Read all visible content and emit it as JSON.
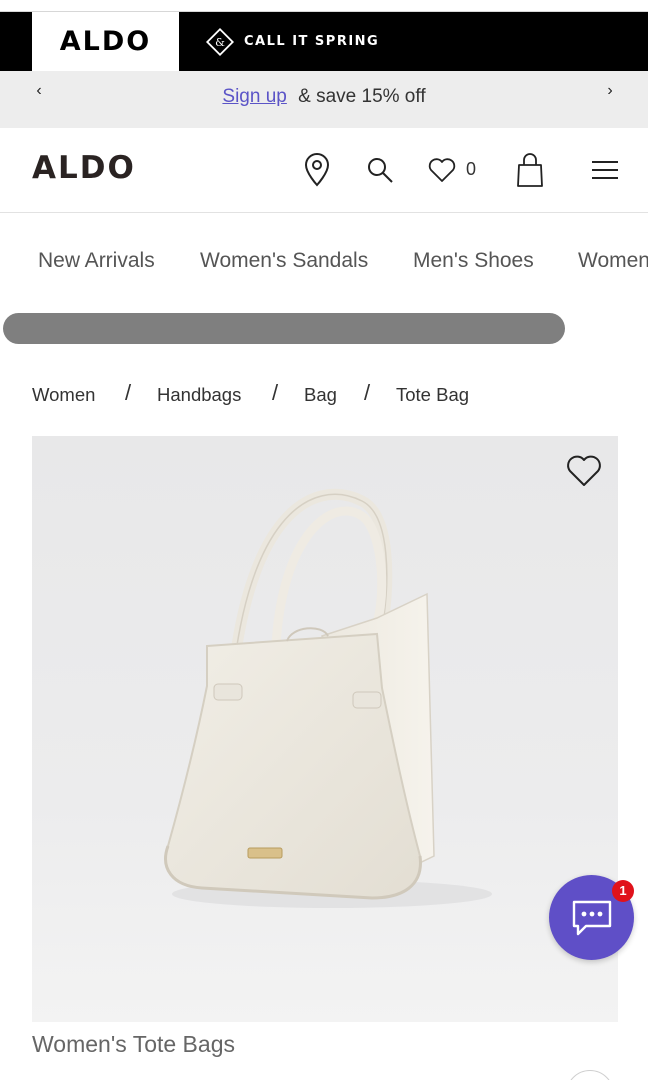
{
  "brand_bar": {
    "logo": "ALDO",
    "slogan": "CALL IT SPRING",
    "slogan_icon": "ampersand-diamond-icon"
  },
  "promo": {
    "signup_link": "Sign up",
    "text": "& save 15% off",
    "prev_icon": "chevron-left-icon",
    "next_icon": "chevron-right-icon",
    "prev_glyph": "‹",
    "next_glyph": "›"
  },
  "header": {
    "logo": "ALDO",
    "wishlist_count": "0",
    "icons": [
      "location-pin-icon",
      "search-icon",
      "heart-icon",
      "shopping-bag-icon",
      "hamburger-menu-icon"
    ]
  },
  "nav": {
    "items": [
      "New Arrivals",
      "Women's Sandals",
      "Men's Shoes",
      "Women"
    ]
  },
  "breadcrumb": {
    "items": [
      "Women",
      "Handbags",
      "Bag",
      "Tote Bag"
    ],
    "separator": "/"
  },
  "product": {
    "title": "Women's Tote Bags",
    "wishlist_icon": "heart-outline-icon"
  },
  "chat": {
    "badge": "1",
    "icon": "chat-bubble-icon"
  },
  "colors": {
    "accent": "#5f4fc7",
    "link": "#5b54c7",
    "badge": "#e0121b",
    "brand_bar": "#000000"
  }
}
